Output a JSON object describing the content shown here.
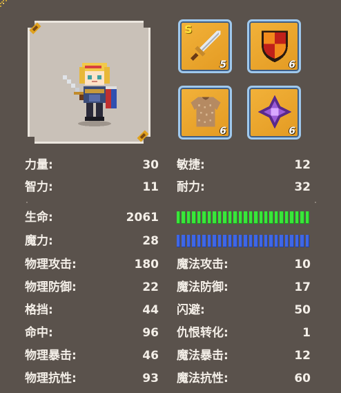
{
  "equipment": [
    {
      "icon": "sword-icon",
      "level": "5",
      "rare_mark": "S"
    },
    {
      "icon": "shield-icon",
      "level": "6"
    },
    {
      "icon": "chainmail-armor-icon",
      "level": "6"
    },
    {
      "icon": "purple-gem-accessory-icon",
      "level": "6"
    }
  ],
  "attributes_left": [
    {
      "label": "力量:",
      "value": "30"
    },
    {
      "label": "智力:",
      "value": "11"
    }
  ],
  "attributes_right": [
    {
      "label": "敏捷:",
      "value": "12"
    },
    {
      "label": "耐力:",
      "value": "32"
    }
  ],
  "vitals": {
    "hp": {
      "label": "生命:",
      "value": "2061",
      "fill": 1.0,
      "color": "#39e63a"
    },
    "mp": {
      "label": "魔力:",
      "value": "28",
      "fill": 1.0,
      "color": "#3f67e6"
    }
  },
  "combat_left": [
    {
      "label": "物理攻击:",
      "value": "180"
    },
    {
      "label": "物理防御:",
      "value": "22"
    },
    {
      "label": "格挡:",
      "value": "44"
    },
    {
      "label": "命中:",
      "value": "96"
    },
    {
      "label": "物理暴击:",
      "value": "46"
    },
    {
      "label": "物理抗性:",
      "value": "93"
    }
  ],
  "combat_right": [
    {
      "label": "魔法攻击:",
      "value": "10"
    },
    {
      "label": "魔法防御:",
      "value": "17"
    },
    {
      "label": "闪避:",
      "value": "50"
    },
    {
      "label": "仇恨转化:",
      "value": "1"
    },
    {
      "label": "魔法暴击:",
      "value": "12"
    },
    {
      "label": "魔法抗性:",
      "value": "60"
    }
  ]
}
